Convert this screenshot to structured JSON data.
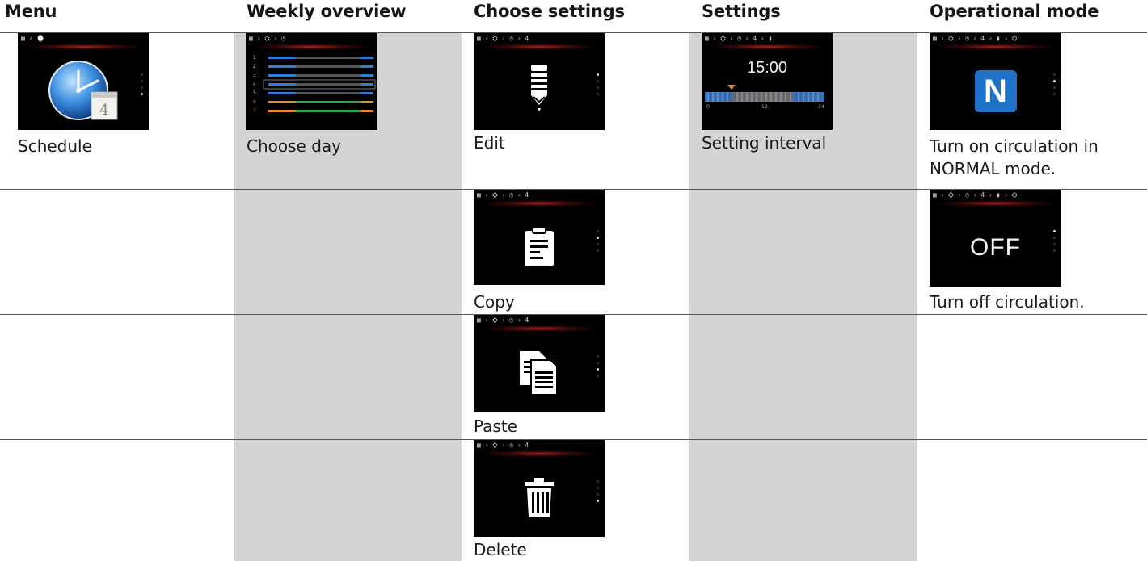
{
  "columns": [
    {
      "header": "Menu"
    },
    {
      "header": "Weekly overview"
    },
    {
      "header": "Choose settings"
    },
    {
      "header": "Settings"
    },
    {
      "header": "Operational mode"
    }
  ],
  "menu": {
    "schedule": {
      "crumb": "▦ › ⌚",
      "label": "Schedule"
    }
  },
  "weekly": {
    "choose_day": {
      "crumb": "▦ › ⛭ › ◷",
      "label": "Choose day"
    },
    "days": [
      "1",
      "2",
      "3",
      "4",
      "5",
      "6",
      "7"
    ]
  },
  "choose_settings": {
    "edit": {
      "crumb": "▦ › ⛭ › ◷ › 4",
      "label": "Edit"
    },
    "copy": {
      "crumb": "▦ › ⛭ › ◷ › 4",
      "label": "Copy"
    },
    "paste": {
      "crumb": "▦ › ⛭ › ◷ › 4",
      "label": "Paste"
    },
    "delete": {
      "crumb": "▦ › ⛭ › ◷ › 4",
      "label": "Delete"
    }
  },
  "settings": {
    "interval": {
      "crumb": "▦ › ⛭ › ◷ › 4 › ▮",
      "label": "Setting interval",
      "time": "15:00",
      "ticks": [
        "0",
        "12",
        "24"
      ]
    }
  },
  "operational": {
    "normal": {
      "crumb": "▦ › ⛭ › ◷ › 4 › ▮ › ⛭",
      "icon_letter": "N",
      "label_line1": "Turn on circulation in",
      "label_line2": "NORMAL mode."
    },
    "off": {
      "crumb": "▦ › ⛭ › ◷ › 4 › ▮ › ⛭",
      "screen_text": "OFF",
      "label": "Turn off circulation."
    }
  },
  "colors": {
    "column_shade": "#d4d4d6",
    "icon_blue": "#1e73c8",
    "bar_blue": "#2f7fd6",
    "bar_orange": "#e8892a",
    "bar_green": "#2fa54a"
  }
}
